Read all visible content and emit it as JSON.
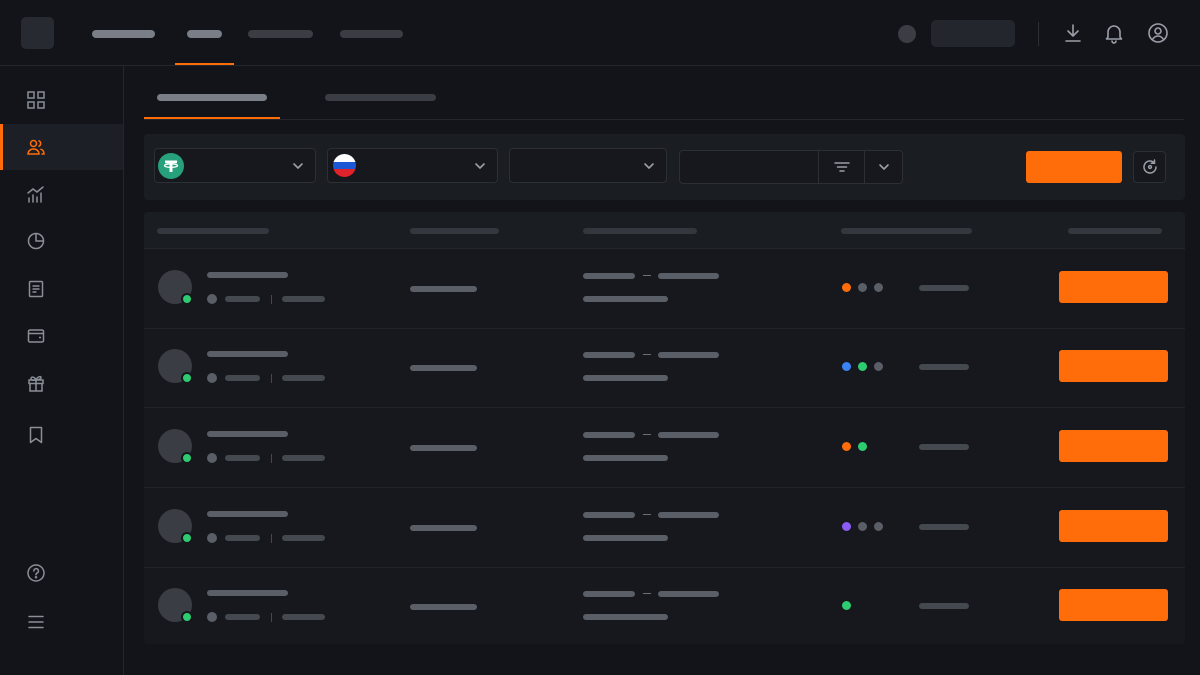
{
  "theme": {
    "accent": "#ff6d0a",
    "background": "#121419",
    "online": "#2ecc71"
  },
  "header": {
    "logo_icon": "app-logo",
    "nav": [
      {
        "label": "",
        "active": false
      },
      {
        "label": "",
        "active": true
      },
      {
        "label": "",
        "active": false
      },
      {
        "label": "",
        "active": false
      }
    ],
    "icons": [
      "download-icon",
      "bell-icon",
      "user-icon"
    ]
  },
  "sidebar": {
    "items": [
      {
        "icon": "grid-icon",
        "active": false
      },
      {
        "icon": "users-icon",
        "active": true
      },
      {
        "icon": "chart-icon",
        "active": false
      },
      {
        "icon": "clock-icon",
        "active": false
      },
      {
        "icon": "document-icon",
        "active": false
      },
      {
        "icon": "wallet-icon",
        "active": false
      },
      {
        "icon": "gift-icon",
        "active": false
      },
      {
        "icon": "bookmark-icon",
        "active": false
      }
    ],
    "bottom": [
      "help-icon",
      "menu-icon"
    ]
  },
  "tabs": [
    {
      "label": "",
      "active": true
    },
    {
      "label": "",
      "active": false
    }
  ],
  "filters": {
    "asset": {
      "icon": "tether-usdt-icon",
      "value": ""
    },
    "currency": {
      "icon": "russia-flag-icon",
      "value": ""
    },
    "payment": {
      "value": ""
    },
    "amount": {
      "value": "",
      "placeholder": ""
    },
    "filter_icon": "filter-icon",
    "search_button": "",
    "refresh_icon": "refresh-icon"
  },
  "table": {
    "columns": [
      "",
      "",
      "",
      "",
      ""
    ],
    "rows": [
      {
        "payment_dots": [
          "#ff6d0a",
          "#5a5e67",
          "#5a5e67"
        ],
        "action": ""
      },
      {
        "payment_dots": [
          "#3b82f6",
          "#2ecc71",
          "#5a5e67"
        ],
        "action": ""
      },
      {
        "payment_dots": [
          "#ff6d0a",
          "#2ecc71"
        ],
        "action": ""
      },
      {
        "payment_dots": [
          "#8b5cf6",
          "#5a5e67",
          "#5a5e67"
        ],
        "action": ""
      },
      {
        "payment_dots": [
          "#2ecc71"
        ],
        "action": ""
      }
    ]
  }
}
